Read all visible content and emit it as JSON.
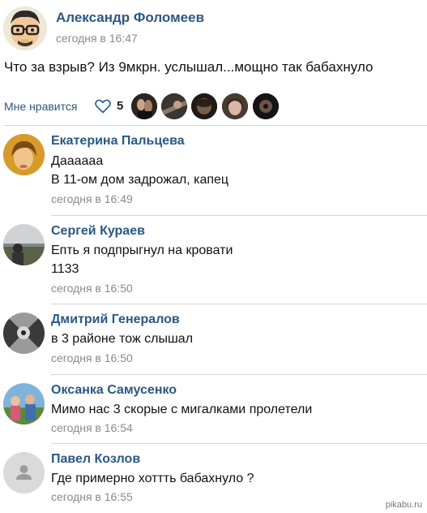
{
  "post": {
    "author": "Александр Фоломеев",
    "time": "сегодня в 16:47",
    "text": "Что за взрыв? Из 9мкрн. услышал...мощно так бабахнуло",
    "avatar_icon": "cartoon-avatar"
  },
  "likes": {
    "label": "Мне нравится",
    "count": "5",
    "icon": "heart-outline-icon"
  },
  "comments": [
    {
      "author": "Екатерина Пальцева",
      "lines": [
        "Даааааа",
        "В 11-ом дом задрожал,  капец"
      ],
      "time": "сегодня в 16:49",
      "avatar_icon": "photo-avatar-woman"
    },
    {
      "author": "Сергей Кураев",
      "lines": [
        "Епть я подпрыгнул на кровати",
        "1133"
      ],
      "time": "сегодня в 16:50",
      "avatar_icon": "photo-avatar-landscape"
    },
    {
      "author": "Дмитрий Генералов",
      "lines": [
        "в 3 районе тож слышал"
      ],
      "time": "сегодня в 16:50",
      "avatar_icon": "photo-avatar-bw"
    },
    {
      "author": "Оксанка Самусенко",
      "lines": [
        "Мимо нас 3 скорые с мигалками пролетели"
      ],
      "time": "сегодня в 16:54",
      "avatar_icon": "photo-avatar-group"
    },
    {
      "author": "Павел Козлов",
      "lines": [
        "Где примерно хоттть бабахнуло ?"
      ],
      "time": "сегодня в 16:55",
      "avatar_icon": "default-user-icon"
    }
  ],
  "watermark": "pikabu.ru",
  "colors": {
    "link": "#2a5885",
    "meta": "#8a8a8a",
    "divider": "#d3d3d3"
  }
}
